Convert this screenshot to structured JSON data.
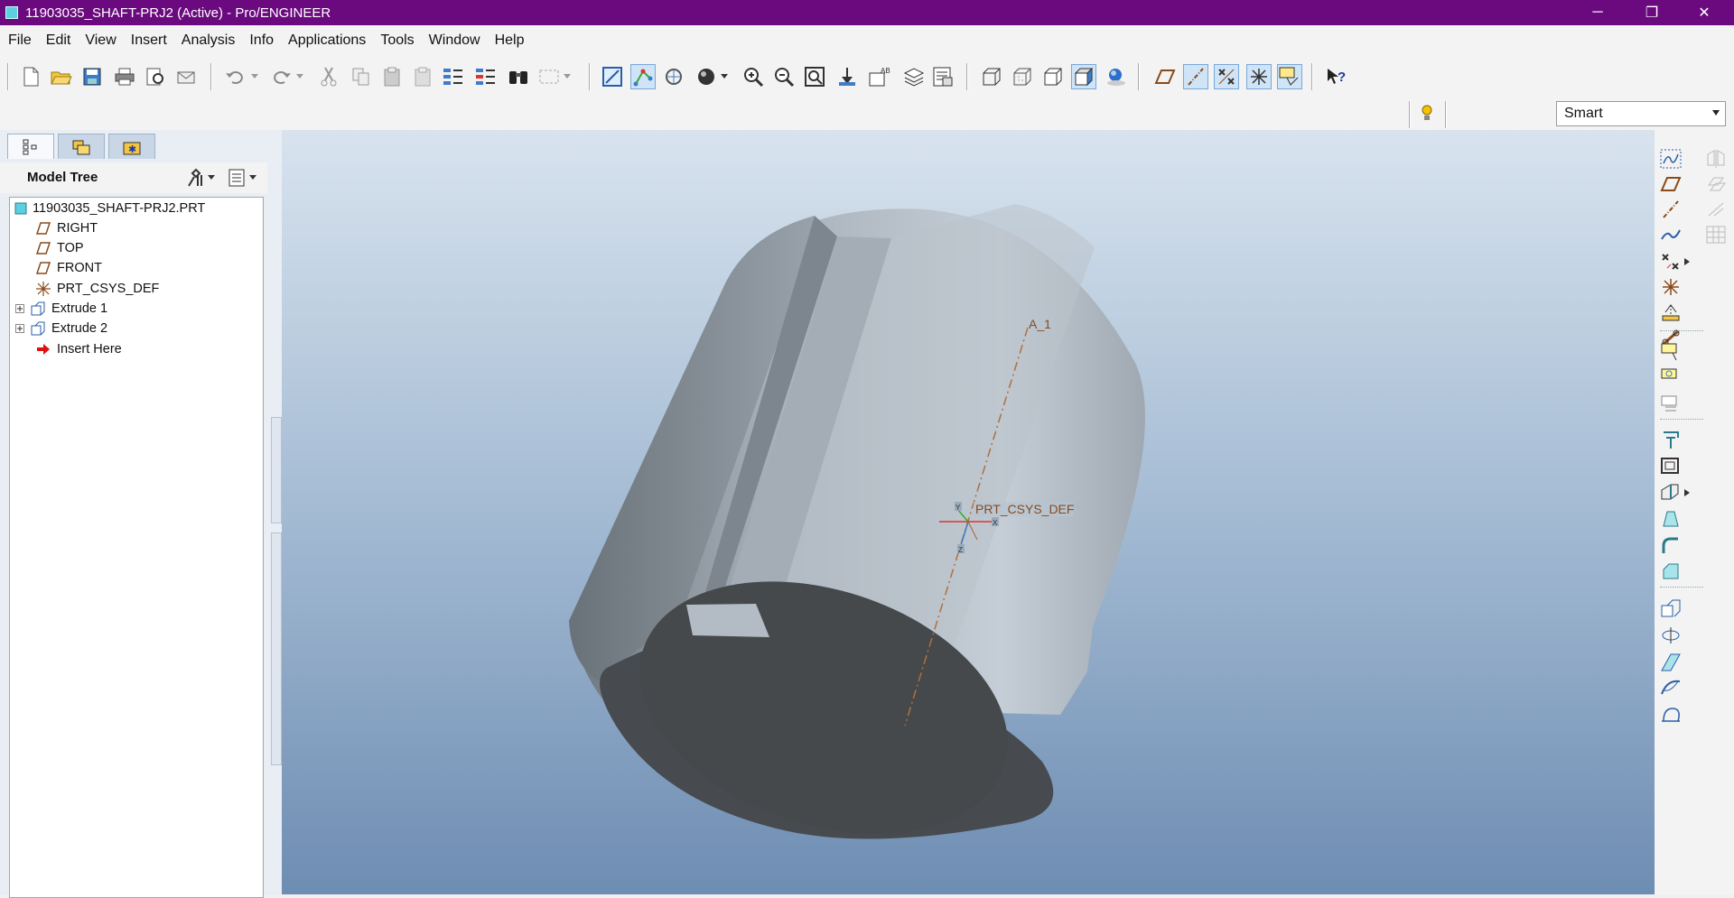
{
  "window": {
    "title": "11903035_SHAFT-PRJ2 (Active) - Pro/ENGINEER",
    "controls": {
      "minimize": "─",
      "restore": "❐",
      "close": "✕"
    }
  },
  "menu": {
    "items": [
      "File",
      "Edit",
      "View",
      "Insert",
      "Analysis",
      "Info",
      "Applications",
      "Tools",
      "Window",
      "Help"
    ]
  },
  "toolbar": {
    "icons": [
      "new-file-icon",
      "open-file-icon",
      "save-icon",
      "print-icon",
      "print-preview-icon",
      "email-icon",
      "undo-icon",
      "redo-icon",
      "cut-icon",
      "copy-icon",
      "paste-icon",
      "paste-special-icon",
      "regenerate-icon",
      "regenerate-manager-icon",
      "find-icon",
      "select-box-icon",
      "repaint-icon",
      "spin-center-icon",
      "orient-icon",
      "appearance-icon",
      "zoom-in-icon",
      "zoom-out-icon",
      "refit-icon",
      "reorient-icon",
      "saved-views-icon",
      "layers-icon",
      "view-manager-icon",
      "wireframe-icon",
      "hidden-line-icon",
      "no-hidden-icon",
      "shading-icon",
      "enhanced-realism-icon",
      "datum-planes-icon",
      "datum-axes-icon",
      "datum-points-icon",
      "csys-icon",
      "annotations-icon",
      "whats-this-icon"
    ],
    "filter_label": "Smart"
  },
  "left_panel": {
    "title": "Model Tree",
    "tree": [
      {
        "label": "11903035_SHAFT-PRJ2.PRT",
        "icon": "part-icon"
      },
      {
        "label": "RIGHT",
        "icon": "datum-plane-icon"
      },
      {
        "label": "TOP",
        "icon": "datum-plane-icon"
      },
      {
        "label": "FRONT",
        "icon": "datum-plane-icon"
      },
      {
        "label": "PRT_CSYS_DEF",
        "icon": "csys-icon"
      },
      {
        "label": "Extrude 1",
        "icon": "extrude-icon",
        "expandable": true
      },
      {
        "label": "Extrude 2",
        "icon": "extrude-icon",
        "expandable": true
      },
      {
        "label": "Insert Here",
        "icon": "insert-arrow-icon"
      }
    ]
  },
  "viewport": {
    "axis_label": "A_1",
    "csys_label": "PRT_CSYS_DEF",
    "csys_axes": {
      "x": "X",
      "y": "Y",
      "z": "Z"
    }
  },
  "colors": {
    "titlebar": "#6a0a7e",
    "datum_plane": "#8a4a1a",
    "axis_line": "#b0703a",
    "model_face": "#aeb7c0",
    "model_cap": "#46494c"
  }
}
